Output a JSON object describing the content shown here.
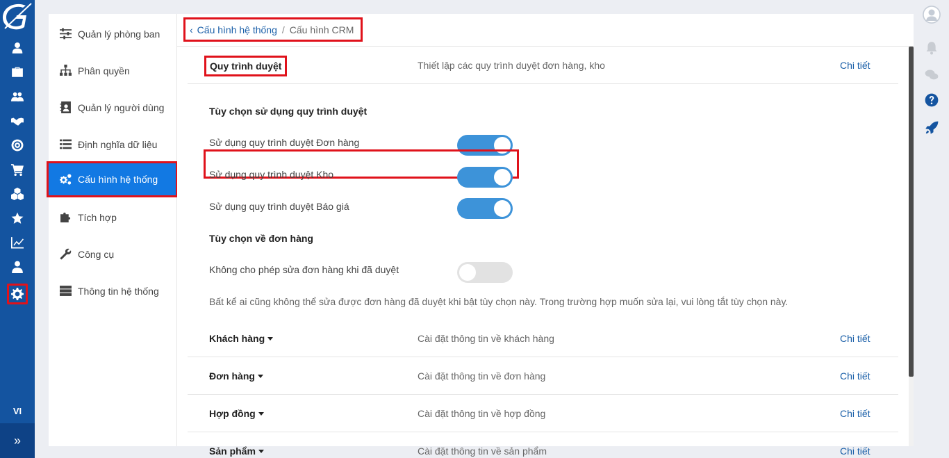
{
  "rail": {
    "items": [
      "user-icon",
      "briefcase-icon",
      "users-icon",
      "handshake-icon",
      "target-icon",
      "cart-icon",
      "cubes-icon",
      "star-icon",
      "chart-icon",
      "person-icon",
      "gear-icon"
    ],
    "lang": "VI",
    "expand_glyph": "»"
  },
  "submenu": {
    "items": [
      {
        "label": "Quản lý phòng ban"
      },
      {
        "label": "Phân quyền"
      },
      {
        "label": "Quản lý người dùng"
      },
      {
        "label": "Định nghĩa dữ liệu"
      },
      {
        "label": "Cấu hình hệ thống"
      },
      {
        "label": "Tích hợp"
      },
      {
        "label": "Công cụ"
      },
      {
        "label": "Thông tin hệ thống"
      }
    ]
  },
  "breadcrumb": {
    "back_glyph": "‹",
    "parent": "Cấu hình hệ thống",
    "separator": "/",
    "current": "Cấu hình CRM"
  },
  "approval": {
    "title": "Quy trình duyệt",
    "description": "Thiết lập các quy trình duyệt đơn hàng, kho",
    "link": "Chi tiết",
    "section1_title": "Tùy chọn sử dụng quy trình duyệt",
    "options": [
      {
        "label": "Sử dụng quy trình duyệt Đơn hàng",
        "enabled": true
      },
      {
        "label": "Sử dụng quy trình duyệt Kho",
        "enabled": true
      },
      {
        "label": "Sử dụng quy trình duyệt Báo giá",
        "enabled": true
      }
    ],
    "section2_title": "Tùy chọn về đơn hàng",
    "order_option": {
      "label": "Không cho phép sửa đơn hàng khi đã duyệt",
      "enabled": false
    },
    "note": "Bất kể ai cũng không thể sửa được đơn hàng đã duyệt khi bật tùy chọn này. Trong trường hợp muốn sửa lại, vui lòng tắt tùy chọn này."
  },
  "sections": [
    {
      "title": "Khách hàng",
      "description": "Cài đặt thông tin về khách hàng",
      "link": "Chi tiết"
    },
    {
      "title": "Đơn hàng",
      "description": "Cài đặt thông tin về đơn hàng",
      "link": "Chi tiết"
    },
    {
      "title": "Hợp đồng",
      "description": "Cài đặt thông tin về hợp đồng",
      "link": "Chi tiết"
    },
    {
      "title": "Sản phẩm",
      "description": "Cài đặt thông tin về sản phẩm",
      "link": "Chi tiết"
    }
  ],
  "colors": {
    "brand": "#1454a0",
    "accent": "#1279e3",
    "toggle_on": "#3d93d9",
    "highlight": "#e0121b"
  }
}
